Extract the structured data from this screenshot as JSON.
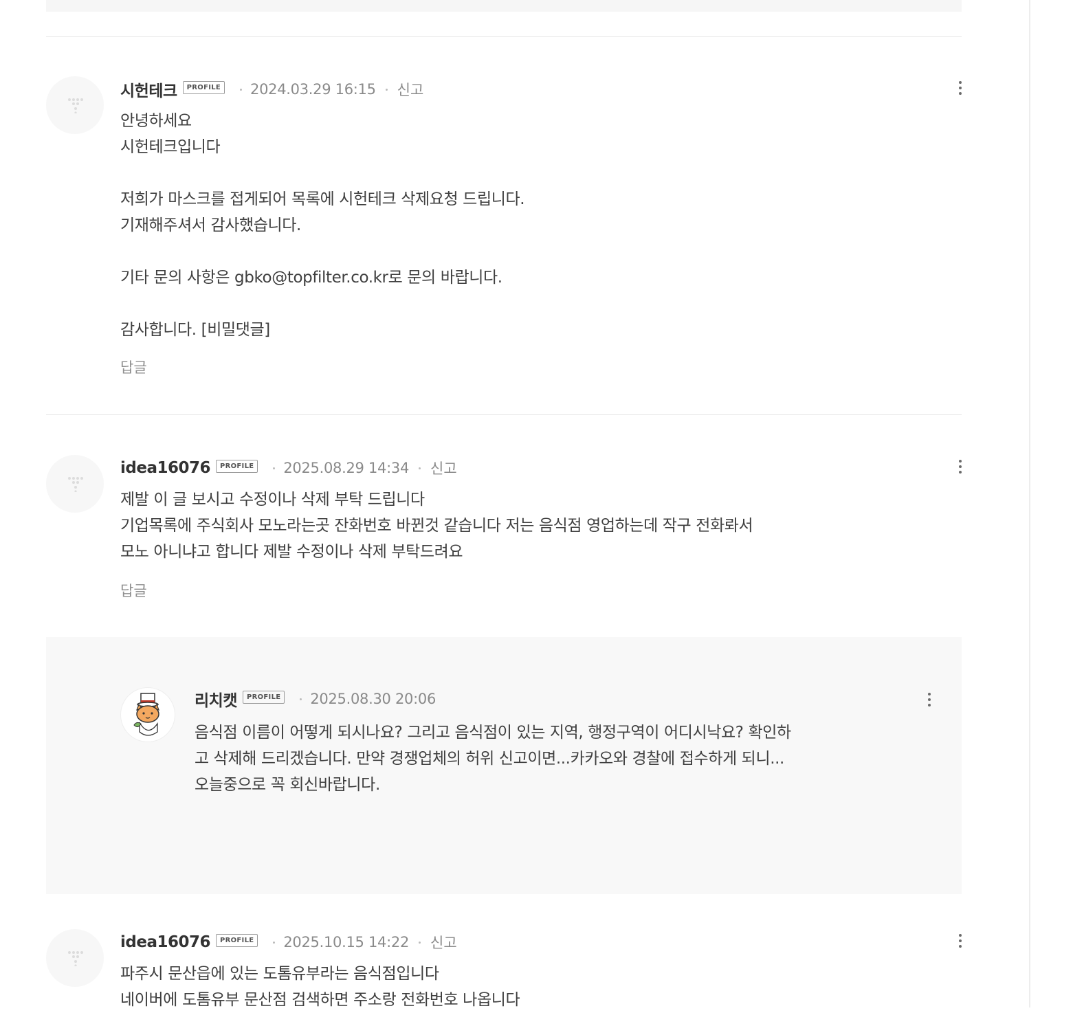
{
  "profile_badge": "PROFILE",
  "report_label": "신고",
  "reply_label": "답글",
  "comments": [
    {
      "author": "시헌테크",
      "date": "2024.03.29 16:15",
      "body": "안녕하세요\n시헌테크입니다\n\n저희가 마스크를 접게되어 목록에 시헌테크 삭제요청 드립니다.\n기재해주셔서 감사했습니다.\n\n기타 문의 사항은 gbko@topfilter.co.kr로 문의 바랍니다.\n\n감사합니다. [비밀댓글]"
    },
    {
      "author": "idea16076",
      "date": "2025.08.29 14:34",
      "body": "제발 이 글 보시고 수정이나 삭제 부탁 드립니다\n기업목록에 주식회사 모노라는곳 잔화번호 바뀐것 같습니다 저는 음식점 영업하는데 작구 전화롸서\n모노 아니냐고 합니다 제발 수정이나 삭제 부탁드려요"
    },
    {
      "author": "idea16076",
      "date": "2025.10.15 14:22",
      "body": "파주시 문산읍에 있는 도톰유부라는 음식점입니다\n네이버에 도톰유부 문산점 검색하면 주소랑 전화번호 나옵니다"
    }
  ],
  "reply": {
    "author": "리치캣",
    "date": "2025.08.30 20:06",
    "body": "음식점 이름이 어떻게 되시나요? 그리고 음식점이 있는 지역, 행정구역이 어디시낙요? 확인하고 삭제해 드리겠습니다. 만약 경쟁업체의 허위 신고이면...카카오와 경찰에 접수하게 되니... 오늘중으로 꼭 회신바랍니다."
  }
}
